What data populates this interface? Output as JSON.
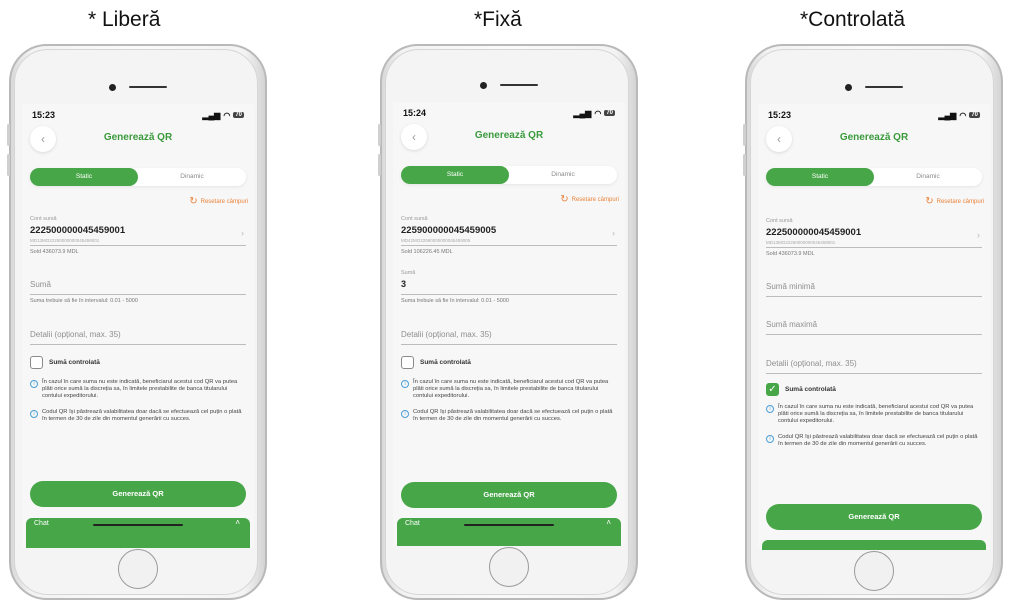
{
  "captions": [
    "* Liberă",
    "*Fixă",
    "*Controlată"
  ],
  "phones": [
    {
      "time": "15:23",
      "title": "Generează QR",
      "tab_static": "Static",
      "tab_dynamic": "Dinamic",
      "reset_label": "Resetare câmpuri",
      "account_label": "Cont sursă",
      "account_number": "222500000045459001",
      "account_sub": "MD13MO22250000000045459001",
      "balance": "Sold 436073.9 MDL",
      "amount_placeholder": "Sumă",
      "amount_hint": "Suma trebuie să fie în intervalul: 0.01 - 5000",
      "details_placeholder": "Detalii (opțional, max. 35)",
      "checkbox_label": "Sumă controlată",
      "checkbox_checked": false,
      "info1": "În cazul în care suma nu este indicată, beneficiarul acestui cod QR va putea plăti orice sumă la discreția sa, în limitele prestabilite de banca titularului contului expeditorului.",
      "info2": "Codul QR își păstrează valabilitatea doar dacă se efectuează cel puțin o plată în termen de 30 de zile din momentul generării cu succes.",
      "button_label": "Generează QR",
      "chat_label": "Chat"
    },
    {
      "time": "15:24",
      "title": "Generează QR",
      "tab_static": "Static",
      "tab_dynamic": "Dinamic",
      "reset_label": "Resetare câmpuri",
      "account_label": "Cont sursă",
      "account_number": "225900000045459005",
      "account_sub": "MD42MO22590000000045459005",
      "balance": "Sold 106226.45 MDL",
      "amount_label": "Sumă",
      "amount_value": "3",
      "amount_hint": "Suma trebuie să fie în intervalul: 0.01 - 5000",
      "details_placeholder": "Detalii (opțional, max. 35)",
      "checkbox_label": "Sumă controlată",
      "checkbox_checked": false,
      "info1": "În cazul în care suma nu este indicată, beneficiarul acestui cod QR va putea plăti orice sumă la discreția sa, în limitele prestabilite de banca titularului contului expeditorului.",
      "info2": "Codul QR își păstrează valabilitatea doar dacă se efectuează cel puțin o plată în termen de 30 de zile din momentul generării cu succes.",
      "button_label": "Generează QR",
      "chat_label": "Chat"
    },
    {
      "time": "15:23",
      "title": "Generează QR",
      "tab_static": "Static",
      "tab_dynamic": "Dinamic",
      "reset_label": "Resetare câmpuri",
      "account_label": "Cont sursă",
      "account_number": "222500000045459001",
      "account_sub": "MD13MO22250000000045459001",
      "balance": "Sold 436073.9 MDL",
      "min_placeholder": "Sumă minimă",
      "max_placeholder": "Sumă maximă",
      "details_placeholder": "Detalii (opțional, max. 35)",
      "checkbox_label": "Sumă controlată",
      "checkbox_checked": true,
      "info1": "În cazul în care suma nu este indicată, beneficiarul acestui cod QR va putea plăti orice sumă la discreția sa, în limitele prestabilite de banca titularului contului expeditorului.",
      "info2": "Codul QR își păstrează valabilitatea doar dacă se efectuează cel puțin o plată în termen de 30 de zile din momentul generării cu succes.",
      "button_label": "Generează QR"
    }
  ],
  "colors": {
    "accent": "#47a648",
    "title": "#3a9a3c",
    "reset": "#e8833a",
    "info": "#4a9ed6"
  }
}
